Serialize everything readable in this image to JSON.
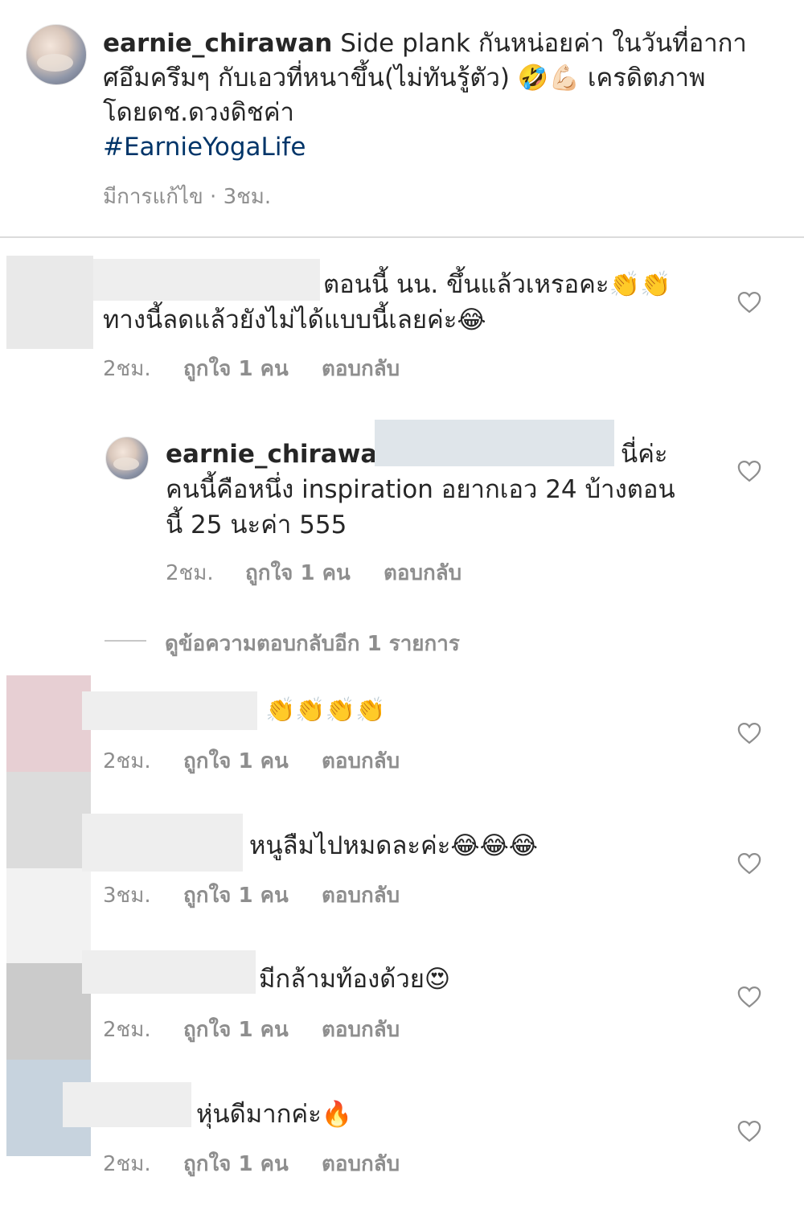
{
  "caption": {
    "username": "earnie_chirawan",
    "line1_text": "Side plank กันหน่อยค่า ในวันที่อากา",
    "line2_text": "ศอึมครึมๆ กับเอวที่หนาขึ้น(ไม่ทันรู้ตัว) 🤣💪🏻 เครดิตภาพ",
    "line3_text": "โดยดช.ดวงดิชค่า",
    "hashtag": "#EarnieYogaLife",
    "meta": "มีการแก้ไข · 3ชม."
  },
  "comments": [
    {
      "line1": "ตอนนี้ นน. ขึ้นแล้วเหรอคะ👏👏",
      "line2": "ทางนี้ลดแล้วยังไม่ได้แบบนี้เลยค่ะ😂",
      "time": "2ชม.",
      "likes": "ถูกใจ 1 คน",
      "reply": "ตอบกลับ"
    },
    {
      "username": "earnie_chirawan",
      "line1_suffix": "นี่ค่ะ",
      "line2": "คนนี้คือหนึ่ง inspiration อยากเอว 24 บ้างตอน",
      "line3": "นี้ 25 นะค่า 555",
      "time": "2ชม.",
      "likes": "ถูกใจ 1 คน",
      "reply": "ตอบกลับ"
    },
    {
      "line1": "👏👏👏👏",
      "time": "2ชม.",
      "likes": "ถูกใจ 1 คน",
      "reply": "ตอบกลับ"
    },
    {
      "line1": "หนูลืมไปหมดละค่ะ😂😂😂",
      "time": "3ชม.",
      "likes": "ถูกใจ 1 คน",
      "reply": "ตอบกลับ"
    },
    {
      "line1": "มีกล้ามท้องด้วย😍",
      "time": "2ชม.",
      "likes": "ถูกใจ 1 คน",
      "reply": "ตอบกลับ"
    },
    {
      "line1": "หุ่นดีมากค่ะ🔥",
      "time": "2ชม.",
      "likes": "ถูกใจ 1 คน",
      "reply": "ตอบกลับ"
    }
  ],
  "view_replies": "ดูข้อความตอบกลับอีก 1 รายการ",
  "icons": {
    "like": "heart-outline-icon",
    "avatar": "profile-avatar"
  },
  "colors": {
    "hashtag": "#003569",
    "meta": "#8e8e8e",
    "divider": "#dbdbdb"
  }
}
